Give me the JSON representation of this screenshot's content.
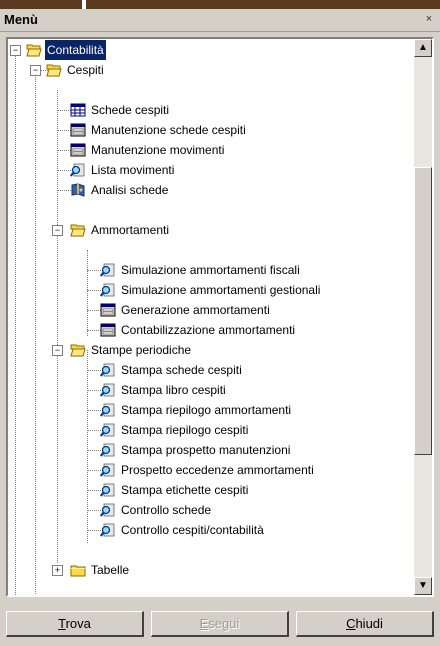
{
  "window": {
    "title": "Menù",
    "close_glyph": "×"
  },
  "tree": {
    "root": {
      "label": "Contabilità",
      "icon": "folder-open-icon",
      "expander": "−"
    },
    "cespiti": {
      "label": "Cespiti",
      "icon": "folder-icon",
      "expander": "−"
    },
    "cespiti_items": [
      {
        "label": "Schede cespiti",
        "icon": "grid-icon"
      },
      {
        "label": "Manutenzione schede cespiti",
        "icon": "form-icon"
      },
      {
        "label": "Manutenzione movimenti",
        "icon": "form-icon"
      },
      {
        "label": "Lista movimenti",
        "icon": "magnifier-icon"
      },
      {
        "label": "Analisi schede",
        "icon": "book-icon"
      }
    ],
    "ammortamenti": {
      "label": "Ammortamenti",
      "icon": "folder-icon",
      "expander": "−"
    },
    "ammortamenti_items": [
      {
        "label": "Simulazione ammortamenti fiscali",
        "icon": "magnifier-icon"
      },
      {
        "label": "Simulazione ammortamenti gestionali",
        "icon": "magnifier-icon"
      },
      {
        "label": "Generazione ammortamenti",
        "icon": "form-icon"
      },
      {
        "label": "Contabilizzazione ammortamenti",
        "icon": "form-icon"
      }
    ],
    "stampe": {
      "label": "Stampe periodiche",
      "icon": "folder-icon",
      "expander": "−"
    },
    "stampe_items": [
      {
        "label": "Stampa schede cespiti",
        "icon": "magnifier-icon"
      },
      {
        "label": "Stampa libro cespiti",
        "icon": "magnifier-icon"
      },
      {
        "label": "Stampa riepilogo ammortamenti",
        "icon": "magnifier-icon"
      },
      {
        "label": "Stampa riepilogo cespiti",
        "icon": "magnifier-icon"
      },
      {
        "label": "Stampa prospetto manutenzioni",
        "icon": "magnifier-icon"
      },
      {
        "label": "Prospetto eccedenze ammortamenti",
        "icon": "magnifier-icon"
      },
      {
        "label": "Stampa etichette cespiti",
        "icon": "magnifier-icon"
      },
      {
        "label": "Controllo schede",
        "icon": "magnifier-icon"
      },
      {
        "label": "Controllo cespiti/contabilità",
        "icon": "magnifier-icon"
      }
    ],
    "tabelle": {
      "label": "Tabelle",
      "icon": "folder-icon",
      "expander": "+"
    }
  },
  "scrollbar": {
    "up": "▲",
    "down": "▼"
  },
  "buttons": {
    "trova": {
      "access": "T",
      "rest": "rova"
    },
    "esegui": {
      "access": "E",
      "rest": "segui"
    },
    "chiudi": {
      "access": "C",
      "rest": "hiudi"
    }
  },
  "colors": {
    "selection": "#0a246a",
    "folder": "#ffd84a",
    "top_strip": "#5c3a1f"
  }
}
